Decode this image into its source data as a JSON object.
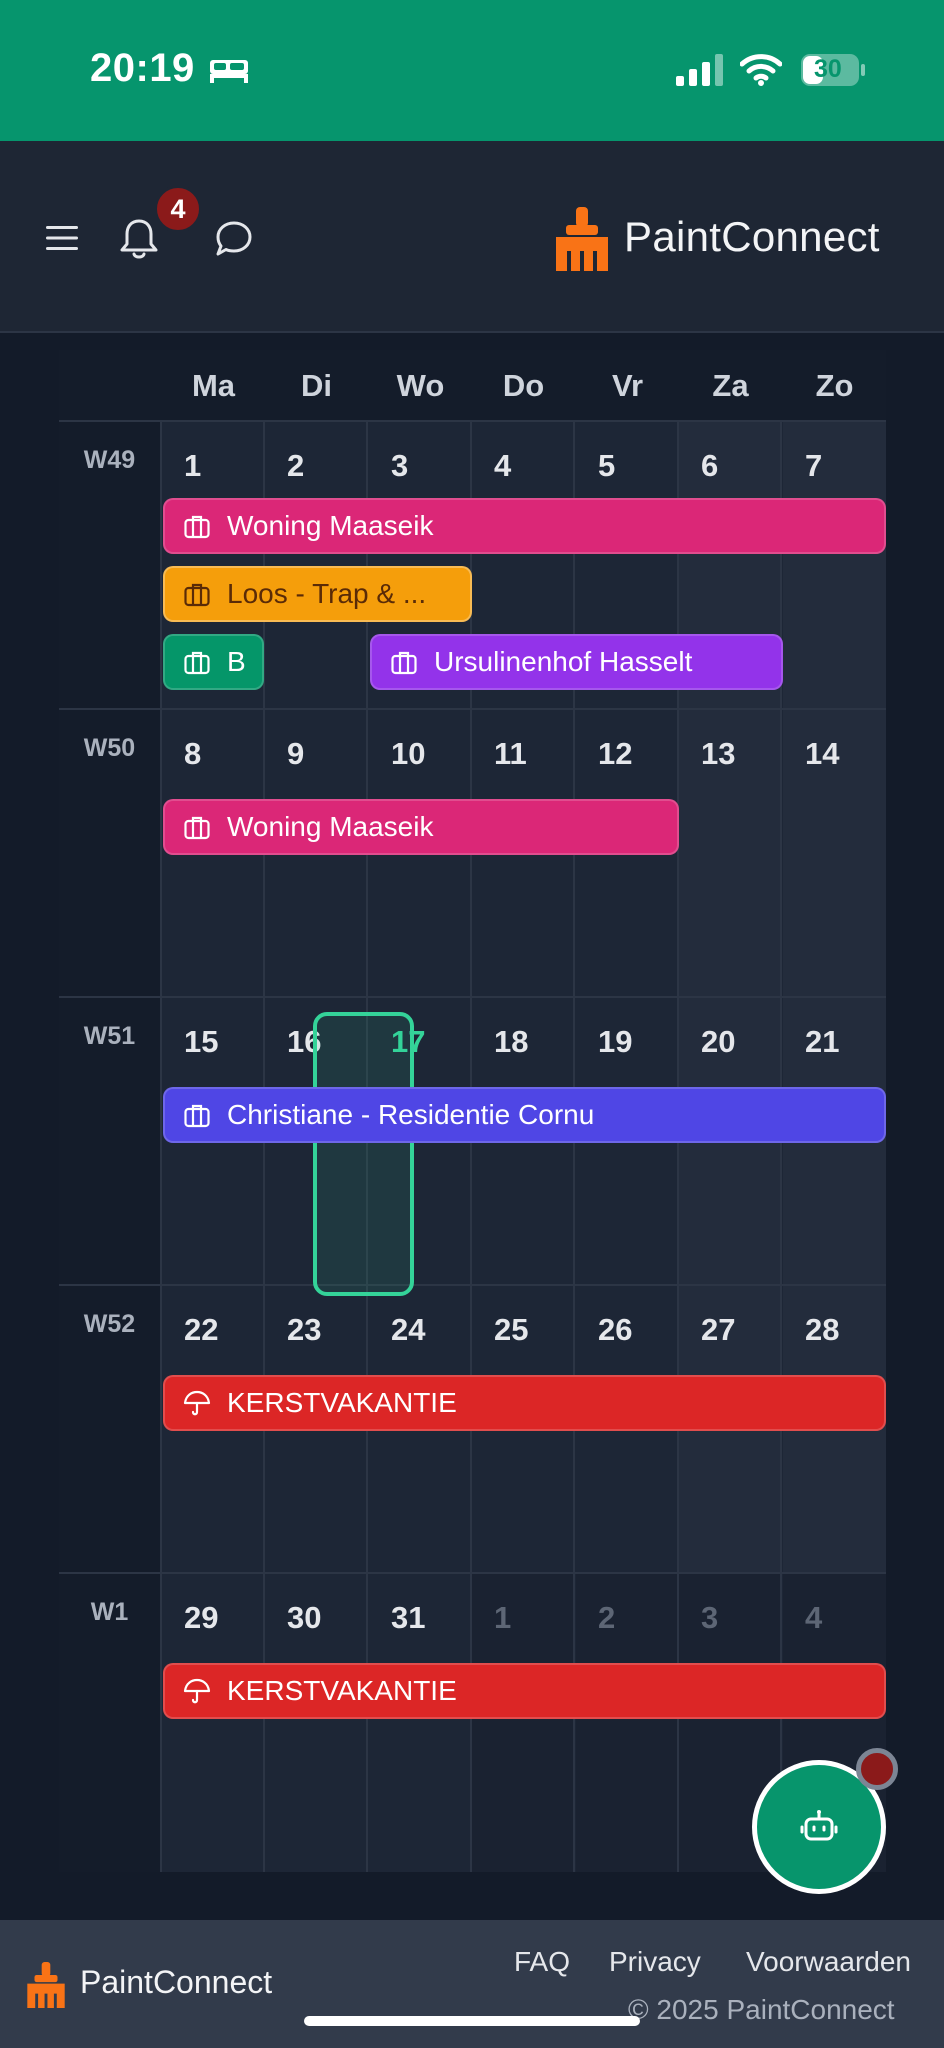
{
  "status_bar": {
    "time": "20:19",
    "battery": "30"
  },
  "header": {
    "notification_count": "4",
    "brand": "PaintConnect"
  },
  "calendar": {
    "day_names": [
      "Ma",
      "Di",
      "Wo",
      "Do",
      "Vr",
      "Za",
      "Zo"
    ],
    "weeks": [
      {
        "label": "W49",
        "days": [
          "1",
          "2",
          "3",
          "4",
          "5",
          "6",
          "7"
        ]
      },
      {
        "label": "W50",
        "days": [
          "8",
          "9",
          "10",
          "11",
          "12",
          "13",
          "14"
        ]
      },
      {
        "label": "W51",
        "days": [
          "15",
          "16",
          "17",
          "18",
          "19",
          "20",
          "21"
        ]
      },
      {
        "label": "W52",
        "days": [
          "22",
          "23",
          "24",
          "25",
          "26",
          "27",
          "28"
        ]
      },
      {
        "label": "W1",
        "days": [
          "29",
          "30",
          "31",
          "1",
          "2",
          "3",
          "4"
        ]
      }
    ],
    "today": "17",
    "events": {
      "w49_woning": "Woning Maaseik",
      "w49_loos": "Loos - Trap & ...",
      "w49_b": "B",
      "w49_ursulinenhof": "Ursulinenhof Hasselt",
      "w50_woning": "Woning Maaseik",
      "w51_christiane": "Christiane - Residentie Cornu",
      "w52_kerst": "KERSTVAKANTIE",
      "w1_kerst": "KERSTVAKANTIE"
    },
    "colors": {
      "pink": "#db2777",
      "orange": "#f59e0b",
      "green": "#059669",
      "purple": "#9333ea",
      "indigo": "#4f46e5",
      "red": "#dc2626",
      "today": "#34d399"
    }
  },
  "fab": {
    "icon": "robot-icon"
  },
  "footer": {
    "brand": "PaintConnect",
    "links": [
      "FAQ",
      "Privacy",
      "Voorwaarden"
    ],
    "copyright": "© 2025 PaintConnect"
  }
}
